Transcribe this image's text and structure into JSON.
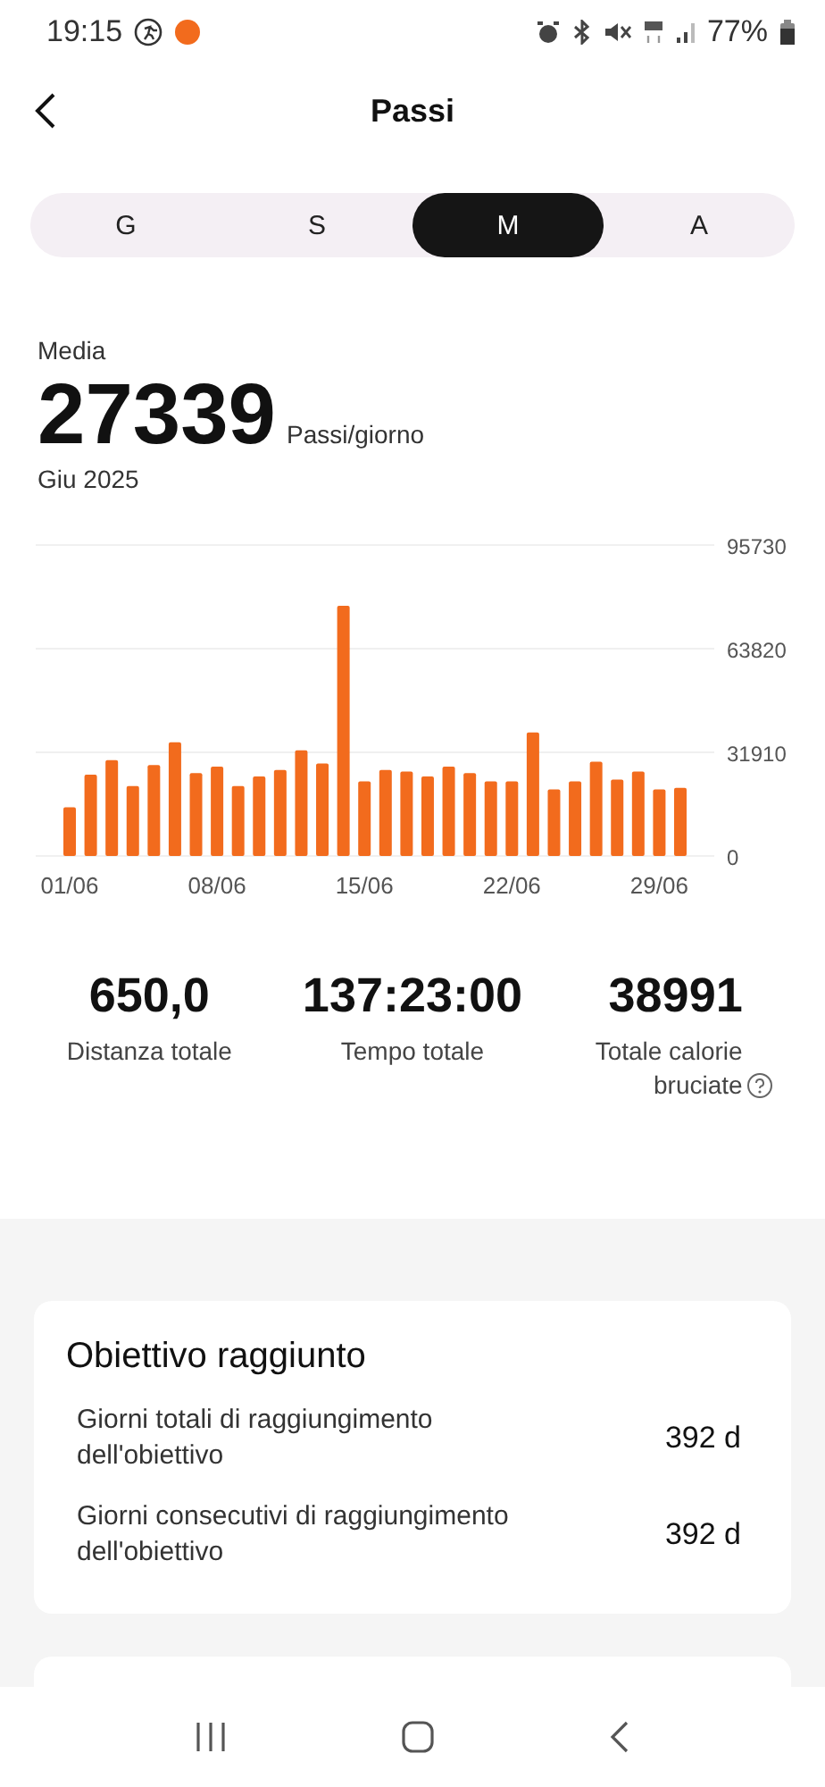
{
  "status_bar": {
    "time": "19:15",
    "battery": "77%"
  },
  "header": {
    "title": "Passi"
  },
  "tabs": [
    {
      "label": "G",
      "selected": false
    },
    {
      "label": "S",
      "selected": false
    },
    {
      "label": "M",
      "selected": true
    },
    {
      "label": "A",
      "selected": false
    }
  ],
  "summary": {
    "label": "Media",
    "value": "27339",
    "unit": "Passi/giorno",
    "period": "Giu 2025"
  },
  "chart_data": {
    "type": "bar",
    "categories": [
      "01/06",
      null,
      null,
      null,
      null,
      null,
      null,
      "08/06",
      null,
      null,
      null,
      null,
      null,
      null,
      "15/06",
      null,
      null,
      null,
      null,
      null,
      null,
      "22/06",
      null,
      null,
      null,
      null,
      null,
      null,
      "29/06",
      null
    ],
    "series": [
      {
        "color": "#f26b1d",
        "values": [
          15000,
          25000,
          29500,
          21500,
          28000,
          35000,
          25500,
          27500,
          21500,
          24500,
          26500,
          32500,
          28500,
          77000,
          23000,
          26500,
          26000,
          24500,
          27500,
          25500,
          23000,
          23000,
          38000,
          20500,
          23000,
          29000,
          23500,
          26000,
          20500,
          21000
        ]
      }
    ],
    "ylim": [
      0,
      95730
    ],
    "yticks": [
      0,
      31910,
      63820,
      95730
    ]
  },
  "stats": [
    {
      "value": "650,0",
      "label": "Distanza totale",
      "help": false
    },
    {
      "value": "137:23:00",
      "label": "Tempo totale",
      "help": false
    },
    {
      "value": "38991",
      "label": "Totale calorie bruciate",
      "help": true
    }
  ],
  "goal_card": {
    "title": "Obiettivo raggiunto",
    "rows": [
      {
        "label": "Giorni totali di raggiungimento dell'obiettivo",
        "value": "392 d"
      },
      {
        "label": "Giorni consecutivi di raggiungimento dell'obiettivo",
        "value": "392 d"
      }
    ]
  }
}
